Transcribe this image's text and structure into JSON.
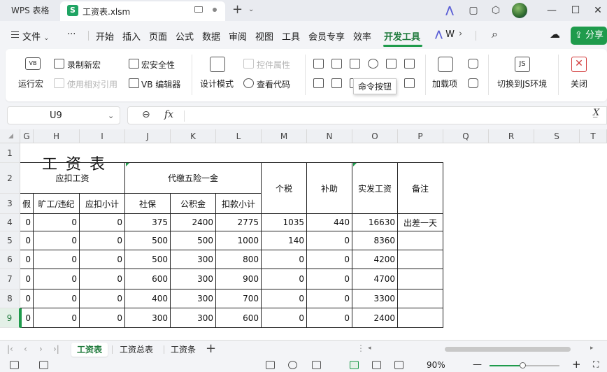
{
  "titlebar": {
    "app_name": "WPS 表格",
    "doc_icon_letter": "S",
    "doc_title": "工资表.xlsm"
  },
  "menubar": {
    "file_label": "文件",
    "more_label": "···",
    "items": [
      "开始",
      "插入",
      "页面",
      "公式",
      "数据",
      "审阅",
      "视图",
      "工具",
      "会员专享",
      "效率",
      "开发工具"
    ],
    "active_item": "开发工具",
    "w_label": "W",
    "share_label": "分享"
  },
  "ribbon": {
    "vb_label": "VB",
    "record_macro": "录制新宏",
    "macro_security": "宏安全性",
    "run_macro": "运行宏",
    "relative_ref": "使用相对引用",
    "vb_editor": "VB 编辑器",
    "design_mode": "设计模式",
    "control_props": "控件属性",
    "view_code": "查看代码",
    "addins": "加载项",
    "js_label": "JS",
    "switch_js": "切换到JS环境",
    "close": "关闭",
    "tooltip": "命令按钮"
  },
  "formula_bar": {
    "name_box": "U9",
    "fx": "fx",
    "formula": ""
  },
  "columns": [
    "G",
    "H",
    "I",
    "J",
    "K",
    "L",
    "M",
    "N",
    "O",
    "P",
    "Q",
    "R",
    "S",
    "T"
  ],
  "rows": [
    "1",
    "2",
    "3",
    "4",
    "5",
    "6",
    "7",
    "8",
    "9"
  ],
  "selected_row": "9",
  "sheet": {
    "title": "工资表",
    "header": {
      "deduct_group": "应扣工资",
      "five_insur_group": "代缴五险一金",
      "tax": "个税",
      "subsidy": "补助",
      "net_pay": "实发工资",
      "remark": "备注",
      "g3": "假",
      "absence": "旷工/违纪",
      "deduct_subtotal": "应扣小计",
      "social": "社保",
      "housing_fund": "公积金",
      "deduct_total": "扣款小计"
    },
    "data": [
      {
        "g": "0",
        "h": "0",
        "i": "0",
        "j": "375",
        "k": "2400",
        "l": "2775",
        "m": "1035",
        "n": "440",
        "o": "16630",
        "p": "出差一天"
      },
      {
        "g": "0",
        "h": "0",
        "i": "0",
        "j": "500",
        "k": "500",
        "l": "1000",
        "m": "140",
        "n": "0",
        "o": "8360",
        "p": ""
      },
      {
        "g": "0",
        "h": "0",
        "i": "0",
        "j": "500",
        "k": "300",
        "l": "800",
        "m": "0",
        "n": "0",
        "o": "4200",
        "p": ""
      },
      {
        "g": "0",
        "h": "0",
        "i": "0",
        "j": "600",
        "k": "300",
        "l": "900",
        "m": "0",
        "n": "0",
        "o": "4700",
        "p": ""
      },
      {
        "g": "0",
        "h": "0",
        "i": "0",
        "j": "400",
        "k": "300",
        "l": "700",
        "m": "0",
        "n": "0",
        "o": "3300",
        "p": ""
      },
      {
        "g": "0",
        "h": "0",
        "i": "0",
        "j": "300",
        "k": "300",
        "l": "600",
        "m": "0",
        "n": "0",
        "o": "2400",
        "p": ""
      }
    ]
  },
  "sheet_tabs": [
    "工资表",
    "工资总表",
    "工资条"
  ],
  "active_sheet_tab": "工资表",
  "statusbar": {
    "zoom": "90%",
    "zoom_fraction": 0.47
  },
  "colors": {
    "accent": "#1f9b4c",
    "brand_icon": "#1fa463"
  }
}
